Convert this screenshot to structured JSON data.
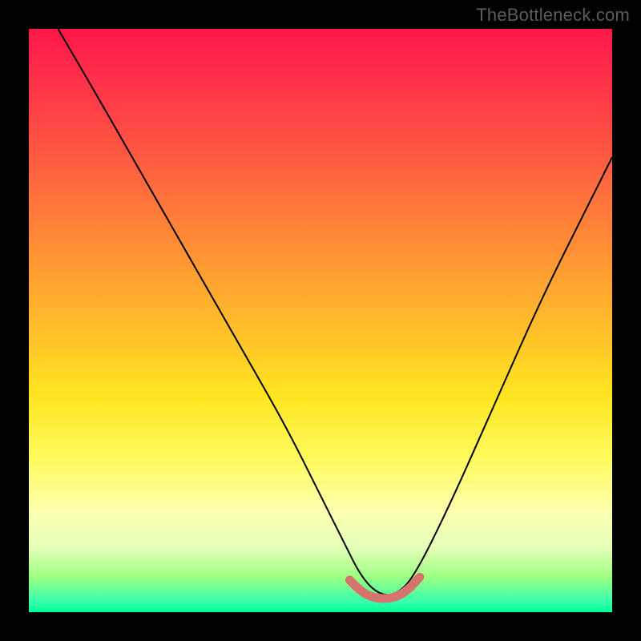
{
  "watermark": "TheBottleneck.com",
  "chart_data": {
    "type": "line",
    "title": "",
    "xlabel": "",
    "ylabel": "",
    "xlim": [
      0,
      100
    ],
    "ylim": [
      0,
      100
    ],
    "series": [
      {
        "name": "bottleneck-curve",
        "x": [
          5,
          12,
          20,
          28,
          36,
          44,
          50,
          54,
          57,
          60,
          63,
          66,
          72,
          80,
          88,
          96,
          100
        ],
        "values": [
          100,
          88,
          74,
          60,
          46,
          32,
          20,
          12,
          6,
          3,
          3,
          6,
          18,
          36,
          54,
          70,
          78
        ]
      }
    ],
    "highlight_segment": {
      "name": "optimal-band",
      "x": [
        55,
        57,
        59,
        61,
        63,
        65,
        67
      ],
      "values": [
        5.5,
        3.5,
        2.5,
        2.3,
        2.6,
        3.8,
        6.0
      ]
    }
  },
  "colors": {
    "curve": "#000000",
    "highlight": "#d5736c",
    "frame": "#000000"
  }
}
